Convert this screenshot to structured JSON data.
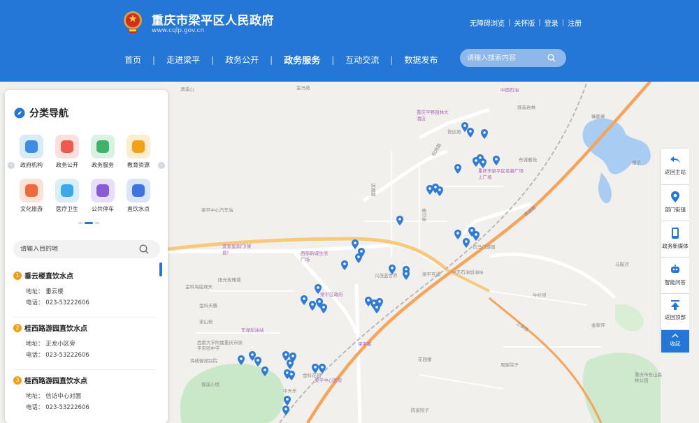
{
  "header": {
    "site_title": "重庆市梁平区人民政府",
    "site_url": "www.cqlp.gov.cn",
    "top_links": [
      "无障碍浏览",
      "关怀版",
      "登录",
      "注册"
    ],
    "nav": [
      {
        "label": "首页",
        "active": false
      },
      {
        "label": "走进梁平",
        "active": false
      },
      {
        "label": "政务公开",
        "active": false
      },
      {
        "label": "政务服务",
        "active": true
      },
      {
        "label": "互动交流",
        "active": false
      },
      {
        "label": "数据发布",
        "active": false
      }
    ],
    "search_placeholder": "请输入搜索内容"
  },
  "panel": {
    "title": "分类导航",
    "categories": [
      {
        "label": "政府机构",
        "icon": "government-building-icon",
        "color": "#3d8ee0"
      },
      {
        "label": "政务公开",
        "icon": "briefcase-icon",
        "color": "#ee5a4e"
      },
      {
        "label": "政务服务",
        "icon": "service-shield-icon",
        "color": "#3eb36b"
      },
      {
        "label": "教育资源",
        "icon": "graduation-cap-icon",
        "color": "#f3a217"
      },
      {
        "label": "文化旅游",
        "icon": "tourism-house-icon",
        "color": "#ef6a3a"
      },
      {
        "label": "医疗卫生",
        "icon": "medical-kit-icon",
        "color": "#3aa9e8"
      },
      {
        "label": "公共停车",
        "icon": "car-icon",
        "color": "#8a5bd6"
      },
      {
        "label": "直饮水点",
        "icon": "water-cup-icon",
        "color": "#3d74e0"
      }
    ],
    "place_search_placeholder": "请输入目的地",
    "results": [
      {
        "num": "1",
        "name": "垂云楼直饮水点",
        "address": "地址： 垂云楼",
        "phone": "电话： 023-53222606"
      },
      {
        "num": "2",
        "name": "桂西路游园直饮水点",
        "address": "地址： 正龙小区旁",
        "phone": "电话： 023-53222606"
      },
      {
        "num": "3",
        "name": "桂西路游园直饮水点",
        "address": "地址： 信访中心对面",
        "phone": "电话： 023-53222606"
      }
    ]
  },
  "toolbar": [
    {
      "label": "返回主站",
      "icon": "back-arrow-icon"
    },
    {
      "label": "部门街镇",
      "icon": "location-pin-icon"
    },
    {
      "label": "政务新媒体",
      "icon": "mobile-phone-icon"
    },
    {
      "label": "智能问答",
      "icon": "robot-icon"
    },
    {
      "label": "返回顶部",
      "icon": "to-top-icon"
    },
    {
      "label": "收起",
      "icon": "collapse-icon"
    }
  ],
  "map": {
    "labels": [
      "清溪山",
      "金马苑",
      "中国石油",
      "观音岩林",
      "蜂鹿寨",
      "楼子",
      "重庆平野园林大酒店",
      "悦达苑",
      "机场路",
      "东城雅苑",
      "重庆市梁平区名豪广场上广场",
      "滨湖路",
      "梁平中心汽车站",
      "梁山路",
      "爱爱皇润门(梁县)",
      "西部新城生活广场",
      "兴茂蓝世界",
      "石马门游园",
      "中天石油加油站",
      "梁平区政府",
      "金科海底观天",
      "阳光玫瑰城",
      "金科天籁",
      "渝山岩",
      "东湖加油站",
      "西南大学附属重庆市梁平实验中学",
      "海成御湖别院",
      "锦溪小馆",
      "中天乐",
      "梁平客",
      "金科花园",
      "花园楼",
      "梁平中心医院",
      "上梁线",
      "高速路",
      "梁平互通",
      "重庆市东山森林公园",
      "陈家院子",
      "周家院子",
      "牛栏坝",
      "金家坪",
      "马鞍河"
    ],
    "accent": "#2f7bd6",
    "road_color": "#f6a45a"
  }
}
